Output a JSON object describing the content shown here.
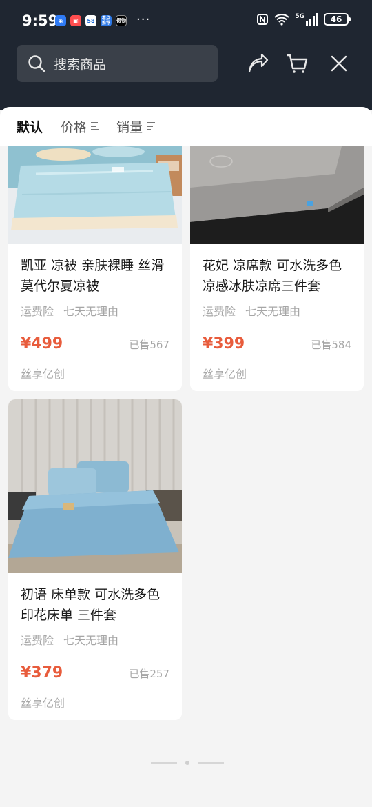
{
  "status_bar": {
    "time": "9:59",
    "apps": [
      "58",
      "看点\n推荐",
      "得物"
    ],
    "more": "···",
    "network": "5G",
    "battery": "46"
  },
  "header": {
    "search_placeholder": "搜索商品",
    "icons": [
      "share-icon",
      "cart-icon",
      "close-icon"
    ]
  },
  "sort": {
    "default_label": "默认",
    "price_label": "价格",
    "sales_label": "销量"
  },
  "products": [
    {
      "title": "凯亚 凉被 亲肤裸睡 丝滑莫代尔夏凉被",
      "tags": [
        "运费险",
        "七天无理由"
      ],
      "price": "¥499",
      "sold": "已售567",
      "shop": "丝享亿创"
    },
    {
      "title": "花妃 凉席款 可水洗多色凉感冰肤凉席三件套",
      "tags": [
        "运费险",
        "七天无理由"
      ],
      "price": "¥399",
      "sold": "已售584",
      "shop": "丝享亿创"
    },
    {
      "title": "初语 床单款 可水洗多色印花床单 三件套",
      "tags": [
        "运费险",
        "七天无理由"
      ],
      "price": "¥379",
      "sold": "已售257",
      "shop": "丝享亿创"
    }
  ],
  "colors": {
    "header_bg": "#1f2631",
    "price": "#e85c3c",
    "muted": "#a6a6a6"
  }
}
